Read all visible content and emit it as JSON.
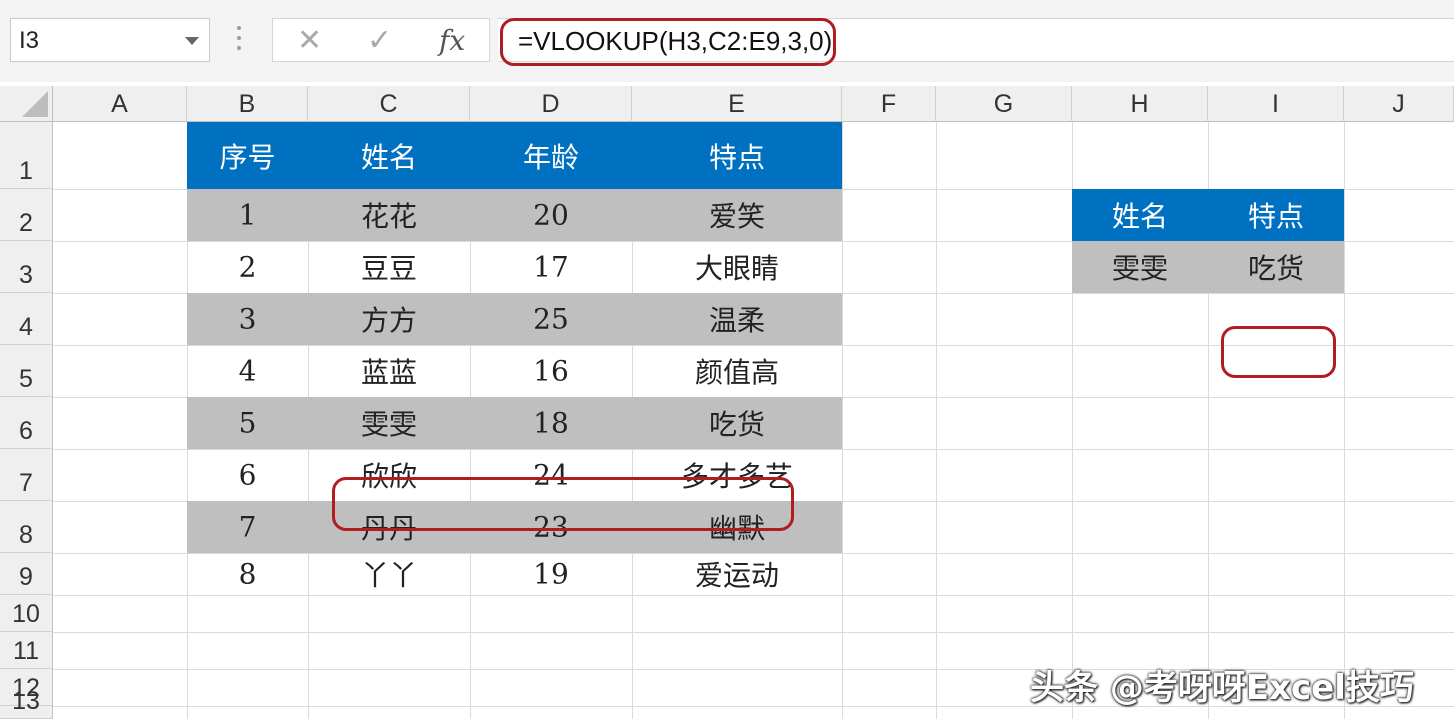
{
  "formula_bar": {
    "name_box": "I3",
    "cancel_glyph": "✕",
    "enter_glyph": "✓",
    "fx_label": "fx",
    "formula": "=VLOOKUP(H3,C2:E9,3,0)"
  },
  "columns": [
    "A",
    "B",
    "C",
    "D",
    "E",
    "F",
    "G",
    "H",
    "I",
    "J"
  ],
  "rows": [
    "1",
    "2",
    "3",
    "4",
    "5",
    "6",
    "7",
    "8",
    "9",
    "10",
    "11",
    "12",
    "13"
  ],
  "main_table": {
    "headers": [
      "序号",
      "姓名",
      "年龄",
      "特点"
    ],
    "rows": [
      [
        "1",
        "花花",
        "20",
        "爱笑"
      ],
      [
        "2",
        "豆豆",
        "17",
        "大眼睛"
      ],
      [
        "3",
        "方方",
        "25",
        "温柔"
      ],
      [
        "4",
        "蓝蓝",
        "16",
        "颜值高"
      ],
      [
        "5",
        "雯雯",
        "18",
        "吃货"
      ],
      [
        "6",
        "欣欣",
        "24",
        "多才多艺"
      ],
      [
        "7",
        "丹丹",
        "23",
        "幽默"
      ],
      [
        "8",
        "丫丫",
        "19",
        "爱运动"
      ]
    ]
  },
  "lookup_table": {
    "headers": [
      "姓名",
      "特点"
    ],
    "row": [
      "雯雯",
      "吃货"
    ]
  },
  "colors": {
    "header_blue": "#0070c0",
    "row_gray": "#bfbfbf",
    "highlight_red": "#b01c22"
  },
  "watermark": "头条 @考呀呀Excel技巧"
}
